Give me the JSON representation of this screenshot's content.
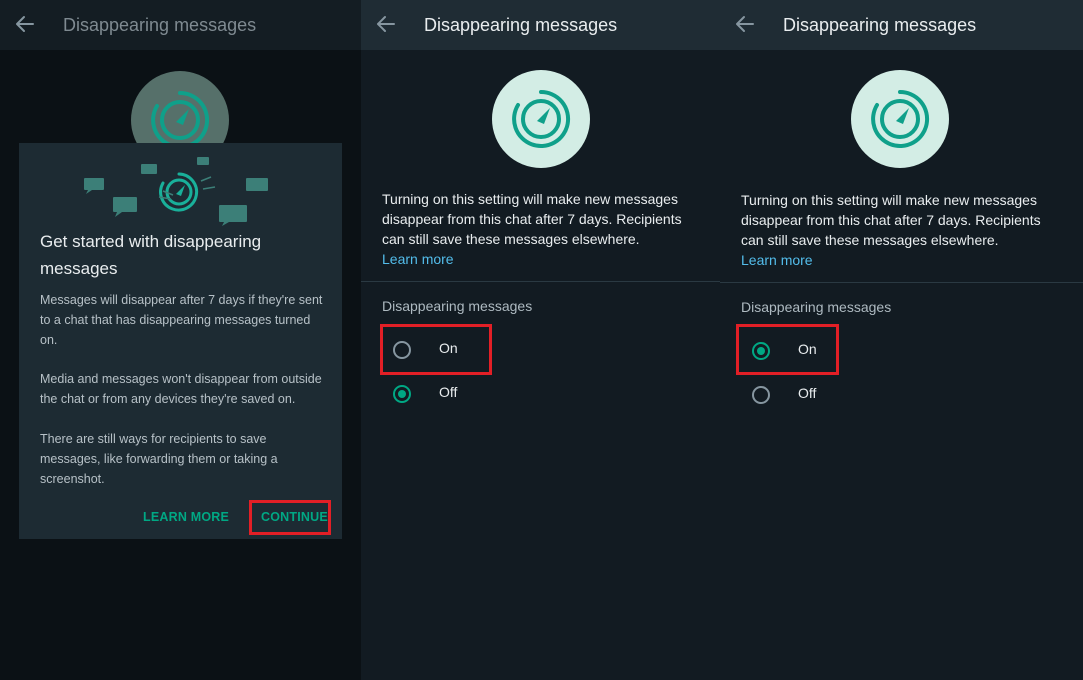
{
  "panels": {
    "left": {
      "header": {
        "title": "Disappearing messages",
        "back_icon": "arrow-left-icon"
      },
      "dialog": {
        "title": "Get started with disappearing messages",
        "paragraphs": [
          "Messages will disappear after 7 days if they're sent to a chat that has disappearing messages turned on.",
          "Media and messages won't disappear from outside the chat or from any devices they're saved on.",
          "There are still ways for recipients to save messages, like forwarding them or taking a screenshot."
        ],
        "learn_more_label": "LEARN MORE",
        "continue_label": "CONTINUE"
      }
    },
    "middle": {
      "header": {
        "title": "Disappearing messages",
        "back_icon": "arrow-left-icon"
      },
      "description": "Turning on this setting will make new messages disappear from this chat after 7 days. Recipients can still save these messages elsewhere.",
      "learn_more": "Learn more",
      "section_label": "Disappearing messages",
      "options": [
        {
          "label": "On",
          "selected": false
        },
        {
          "label": "Off",
          "selected": true
        }
      ]
    },
    "right": {
      "header": {
        "title": "Disappearing messages",
        "back_icon": "arrow-left-icon"
      },
      "description": "Turning on this setting will make new messages disappear from this chat after 7 days. Recipients can still save these messages elsewhere.",
      "learn_more": "Learn more",
      "section_label": "Disappearing messages",
      "options": [
        {
          "label": "On",
          "selected": true
        },
        {
          "label": "Off",
          "selected": false
        }
      ]
    }
  },
  "colors": {
    "accent": "#00a884",
    "link": "#53bdeb",
    "highlight": "#e21f26",
    "background": "#121b22",
    "header": "#1f2c34"
  }
}
